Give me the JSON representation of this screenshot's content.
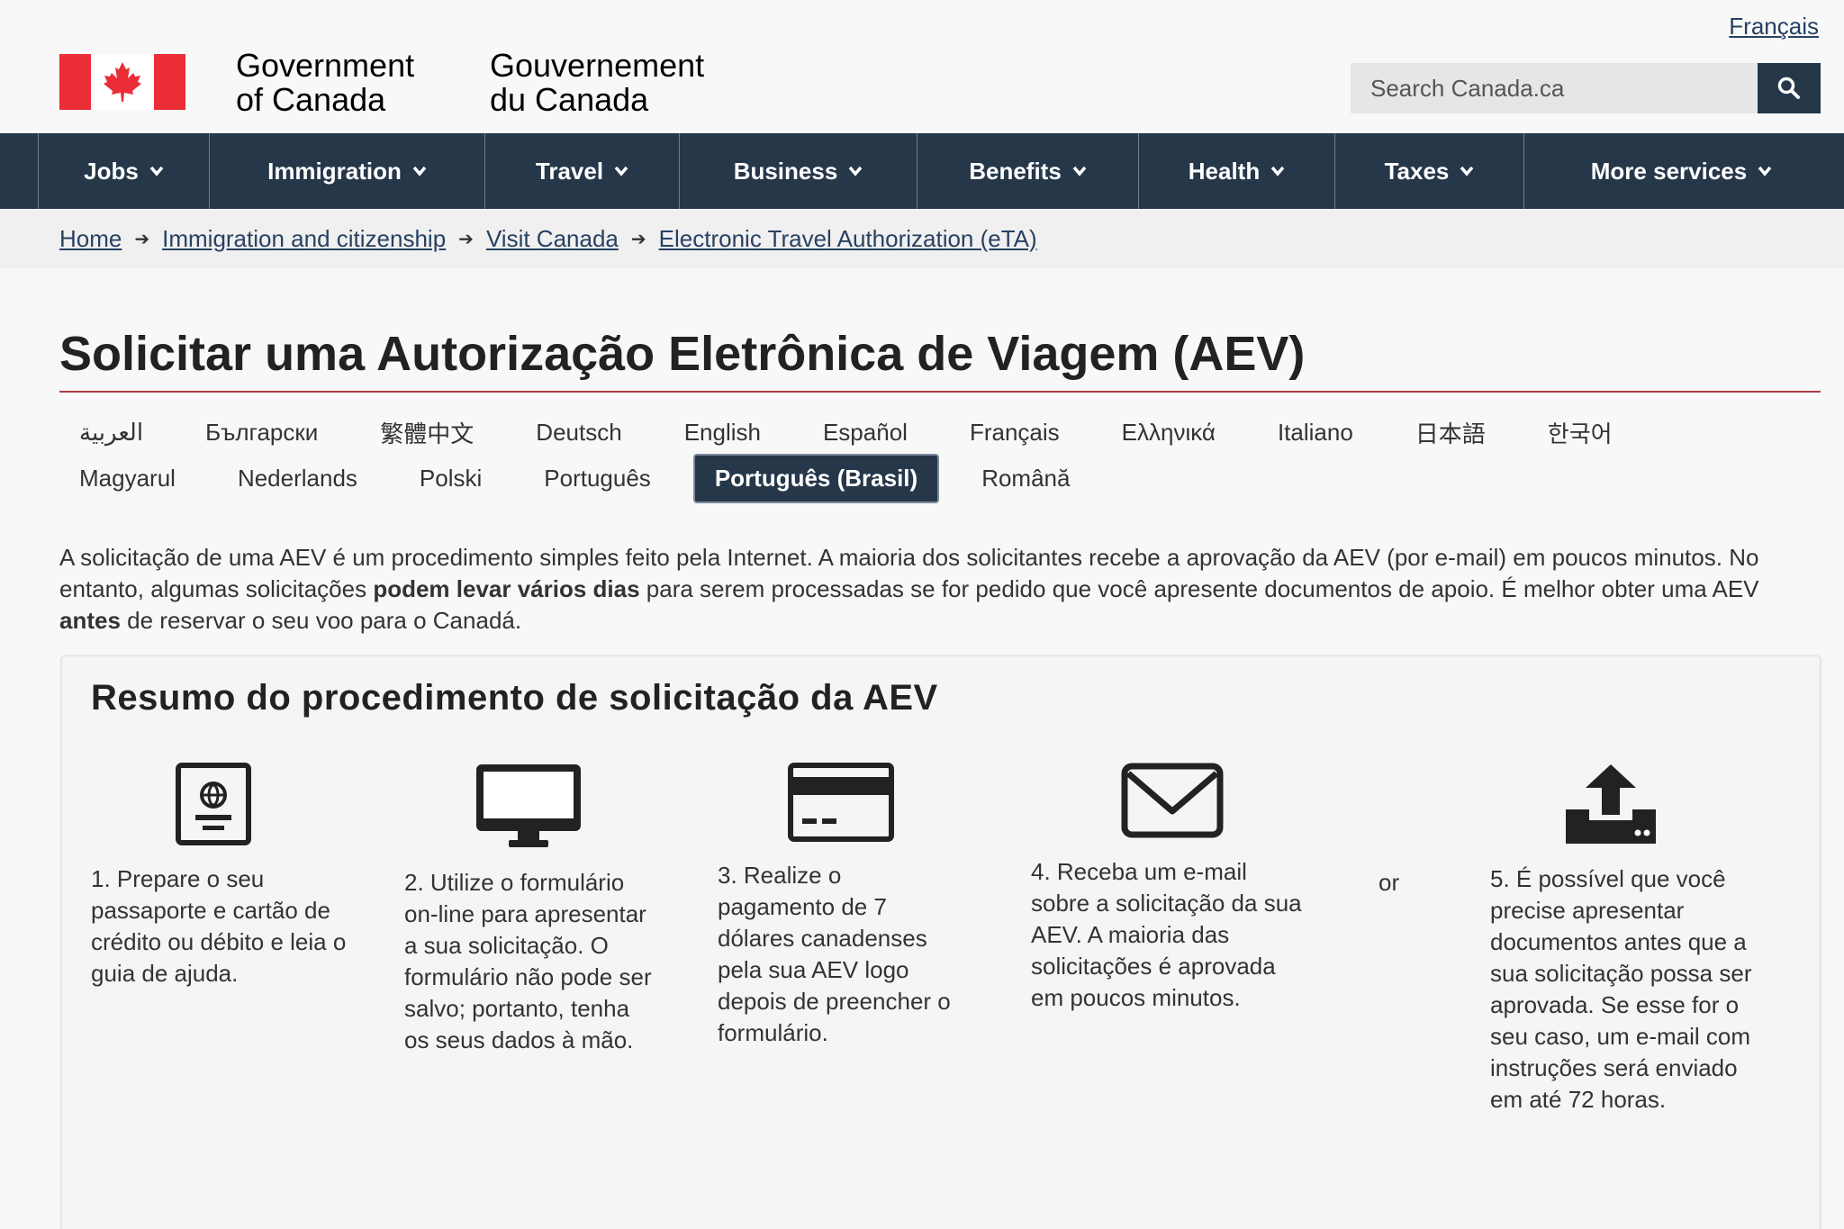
{
  "header": {
    "lang_toggle": "Français",
    "gov_en_line1": "Government",
    "gov_en_line2": "of Canada",
    "gov_fr_line1": "Gouvernement",
    "gov_fr_line2": "du Canada",
    "search_placeholder": "Search Canada.ca",
    "flag_red": "#eb2d37"
  },
  "nav": {
    "items": [
      {
        "label": "Jobs"
      },
      {
        "label": "Immigration"
      },
      {
        "label": "Travel"
      },
      {
        "label": "Business"
      },
      {
        "label": "Benefits"
      },
      {
        "label": "Health"
      },
      {
        "label": "Taxes"
      },
      {
        "label": "More services"
      }
    ]
  },
  "breadcrumb": {
    "items": [
      {
        "label": "Home"
      },
      {
        "label": "Immigration and citizenship"
      },
      {
        "label": "Visit Canada"
      },
      {
        "label": "Electronic Travel Authorization (eTA)"
      }
    ],
    "separator": "➔"
  },
  "page": {
    "title": "Solicitar uma Autorização Eletrônica de Viagem (AEV)"
  },
  "languages": {
    "row1": [
      "العربية",
      "Български",
      "繁體中文",
      "Deutsch",
      "English",
      "Español",
      "Français",
      "Ελληνικά",
      "Italiano",
      "日本語",
      "한국어"
    ],
    "row2": [
      "Magyarul",
      "Nederlands",
      "Polski",
      "Português",
      "Português (Brasil)",
      "Română"
    ],
    "active": "Português (Brasil)"
  },
  "intro": {
    "part1": "A solicitação de uma AEV é um procedimento simples feito pela Internet. A maioria dos solicitantes recebe a aprovação da AEV (por e-mail) em poucos minutos. No entanto, algumas solicitações ",
    "bold1": "podem levar vários dias",
    "part2": " para serem processadas se for pedido que você apresente documentos de apoio. É melhor obter uma AEV ",
    "bold2": "antes",
    "part3": " de reservar o seu voo para o Canadá."
  },
  "summary": {
    "title": "Resumo do procedimento de solicitação da AEV",
    "or": "or",
    "steps": [
      {
        "icon": "passport-icon",
        "text": "1. Prepare o seu passaporte e cartão de crédito ou débito e leia o guia de ajuda."
      },
      {
        "icon": "computer-monitor-icon",
        "text": "2. Utilize o formulário on-line para apresentar a sua solicitação. O formulário não pode ser salvo; portanto, tenha os seus dados à mão."
      },
      {
        "icon": "credit-card-icon",
        "text": "3. Realize o pagamento de 7 dólares canadenses pela sua AEV logo depois de preencher o formulário."
      },
      {
        "icon": "envelope-icon",
        "text": "4. Receba um e-mail sobre a solicitação da sua AEV. A maioria das solicitações é aprovada em poucos minutos."
      },
      {
        "icon": "upload-icon",
        "text": "5. É possível que você precise apresentar documentos antes que a sua solicitação possa ser aprovada. Se esse for o seu caso, um e-mail com instruções será enviado em até 72 horas."
      }
    ]
  }
}
